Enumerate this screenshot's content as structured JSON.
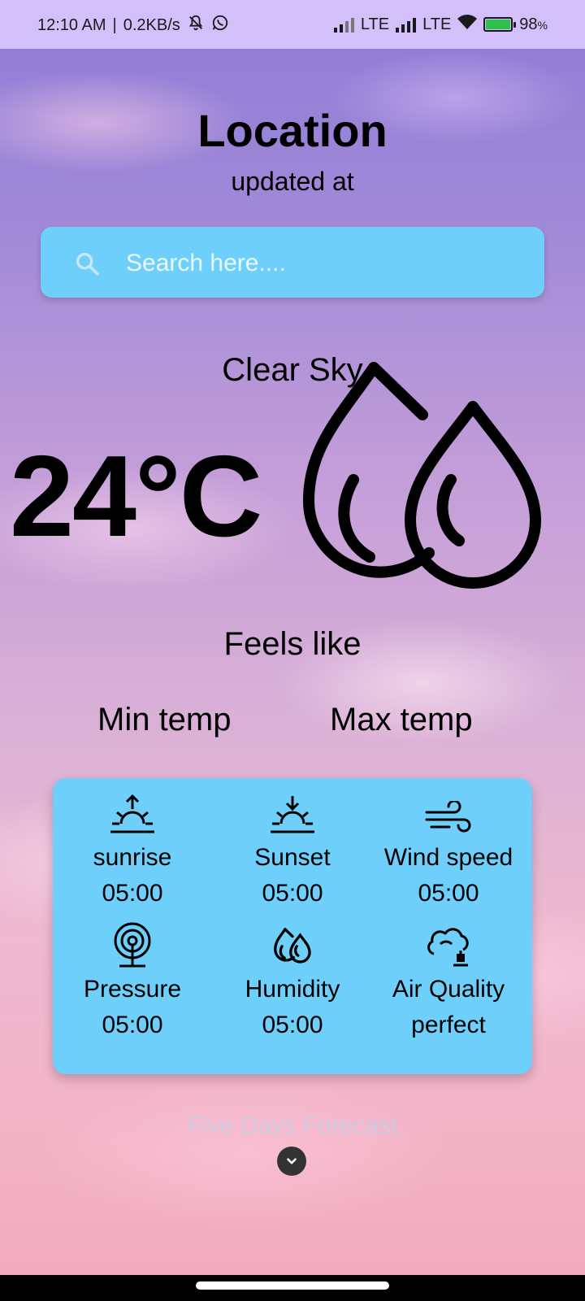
{
  "status_bar": {
    "time": "12:10 AM",
    "separator": "|",
    "net_speed": "0.2KB/s",
    "lte1": "LTE",
    "lte2": "LTE",
    "battery": "98",
    "battery_unit": "%",
    "battery_level": 0.98
  },
  "header": {
    "title": "Location",
    "updated": "updated at"
  },
  "search": {
    "placeholder": "Search here...."
  },
  "weather": {
    "condition": "Clear Sky",
    "temperature": "24°C",
    "feels_like": "Feels like",
    "min_temp": "Min temp",
    "max_temp": "Max temp",
    "icon": "water-drops-icon"
  },
  "details": [
    {
      "label": "sunrise",
      "value": "05:00",
      "icon": "sunrise-icon"
    },
    {
      "label": "Sunset",
      "value": "05:00",
      "icon": "sunset-icon"
    },
    {
      "label": "Wind speed",
      "value": "05:00",
      "icon": "wind-icon"
    },
    {
      "label": "Pressure",
      "value": "05:00",
      "icon": "pressure-icon"
    },
    {
      "label": "Humidity",
      "value": "05:00",
      "icon": "humidity-icon"
    },
    {
      "label": "Air Quality",
      "value": "perfect",
      "icon": "air-quality-icon"
    }
  ],
  "forecast": {
    "label": "Five Days Forecast"
  },
  "colors": {
    "accent": "#6fcffb",
    "status_bar": "#d3c0fb"
  }
}
